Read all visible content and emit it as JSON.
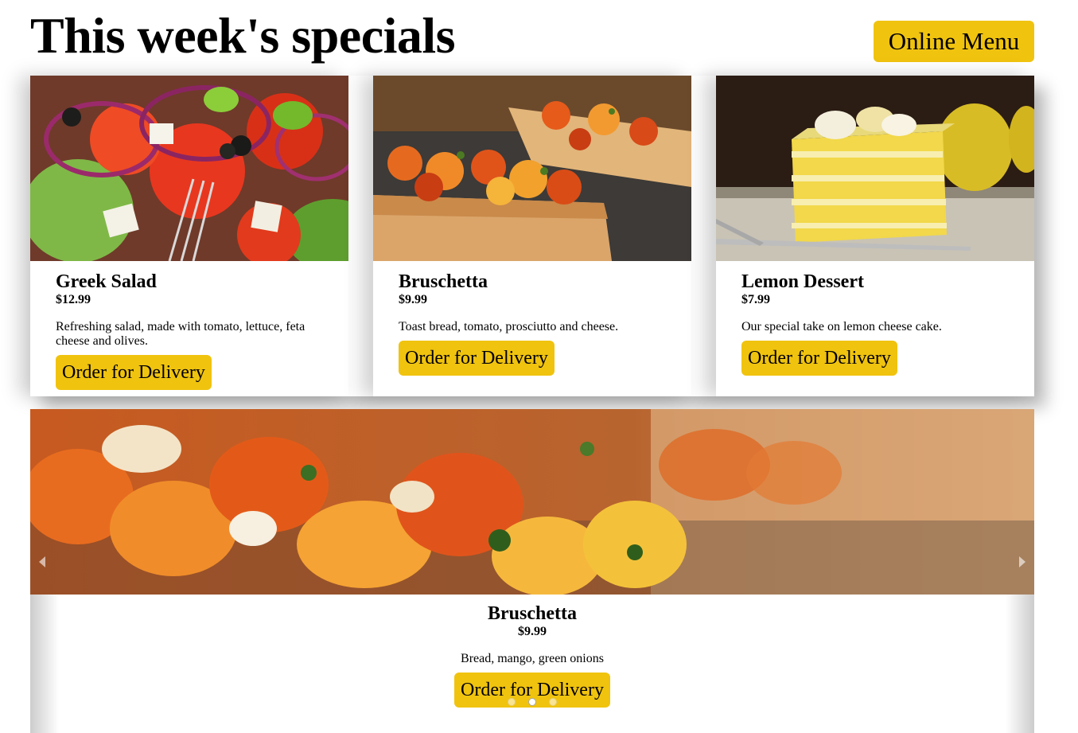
{
  "header": {
    "title": "This week's specials",
    "online_menu_label": "Online Menu"
  },
  "colors": {
    "accent": "#f0c30f",
    "background": "#ffffff",
    "text": "#000000"
  },
  "specials": [
    {
      "name": "Greek Salad",
      "price": "$12.99",
      "description": "Refreshing salad, made with tomato, lettuce, feta cheese and olives.",
      "button_label": "Order for Delivery",
      "image": "greek-salad-photo"
    },
    {
      "name": "Bruschetta",
      "price": "$9.99",
      "description": "Toast bread, tomato, prosciutto and cheese.",
      "button_label": "Order for Delivery",
      "image": "bruschetta-photo"
    },
    {
      "name": "Lemon Dessert",
      "price": "$7.99",
      "description": "Our special take on lemon cheese cake.",
      "button_label": "Order for Delivery",
      "image": "lemon-dessert-photo"
    }
  ],
  "carousel": {
    "slide": {
      "name": "Bruschetta",
      "price": "$9.99",
      "description": "Bread, mango, green onions",
      "button_label": "Order for Delivery",
      "image": "bruschetta-closeup-photo"
    },
    "dot_count": 3,
    "active_dot": 1,
    "icons": [
      "chevron-left-icon",
      "chevron-right-icon"
    ]
  }
}
